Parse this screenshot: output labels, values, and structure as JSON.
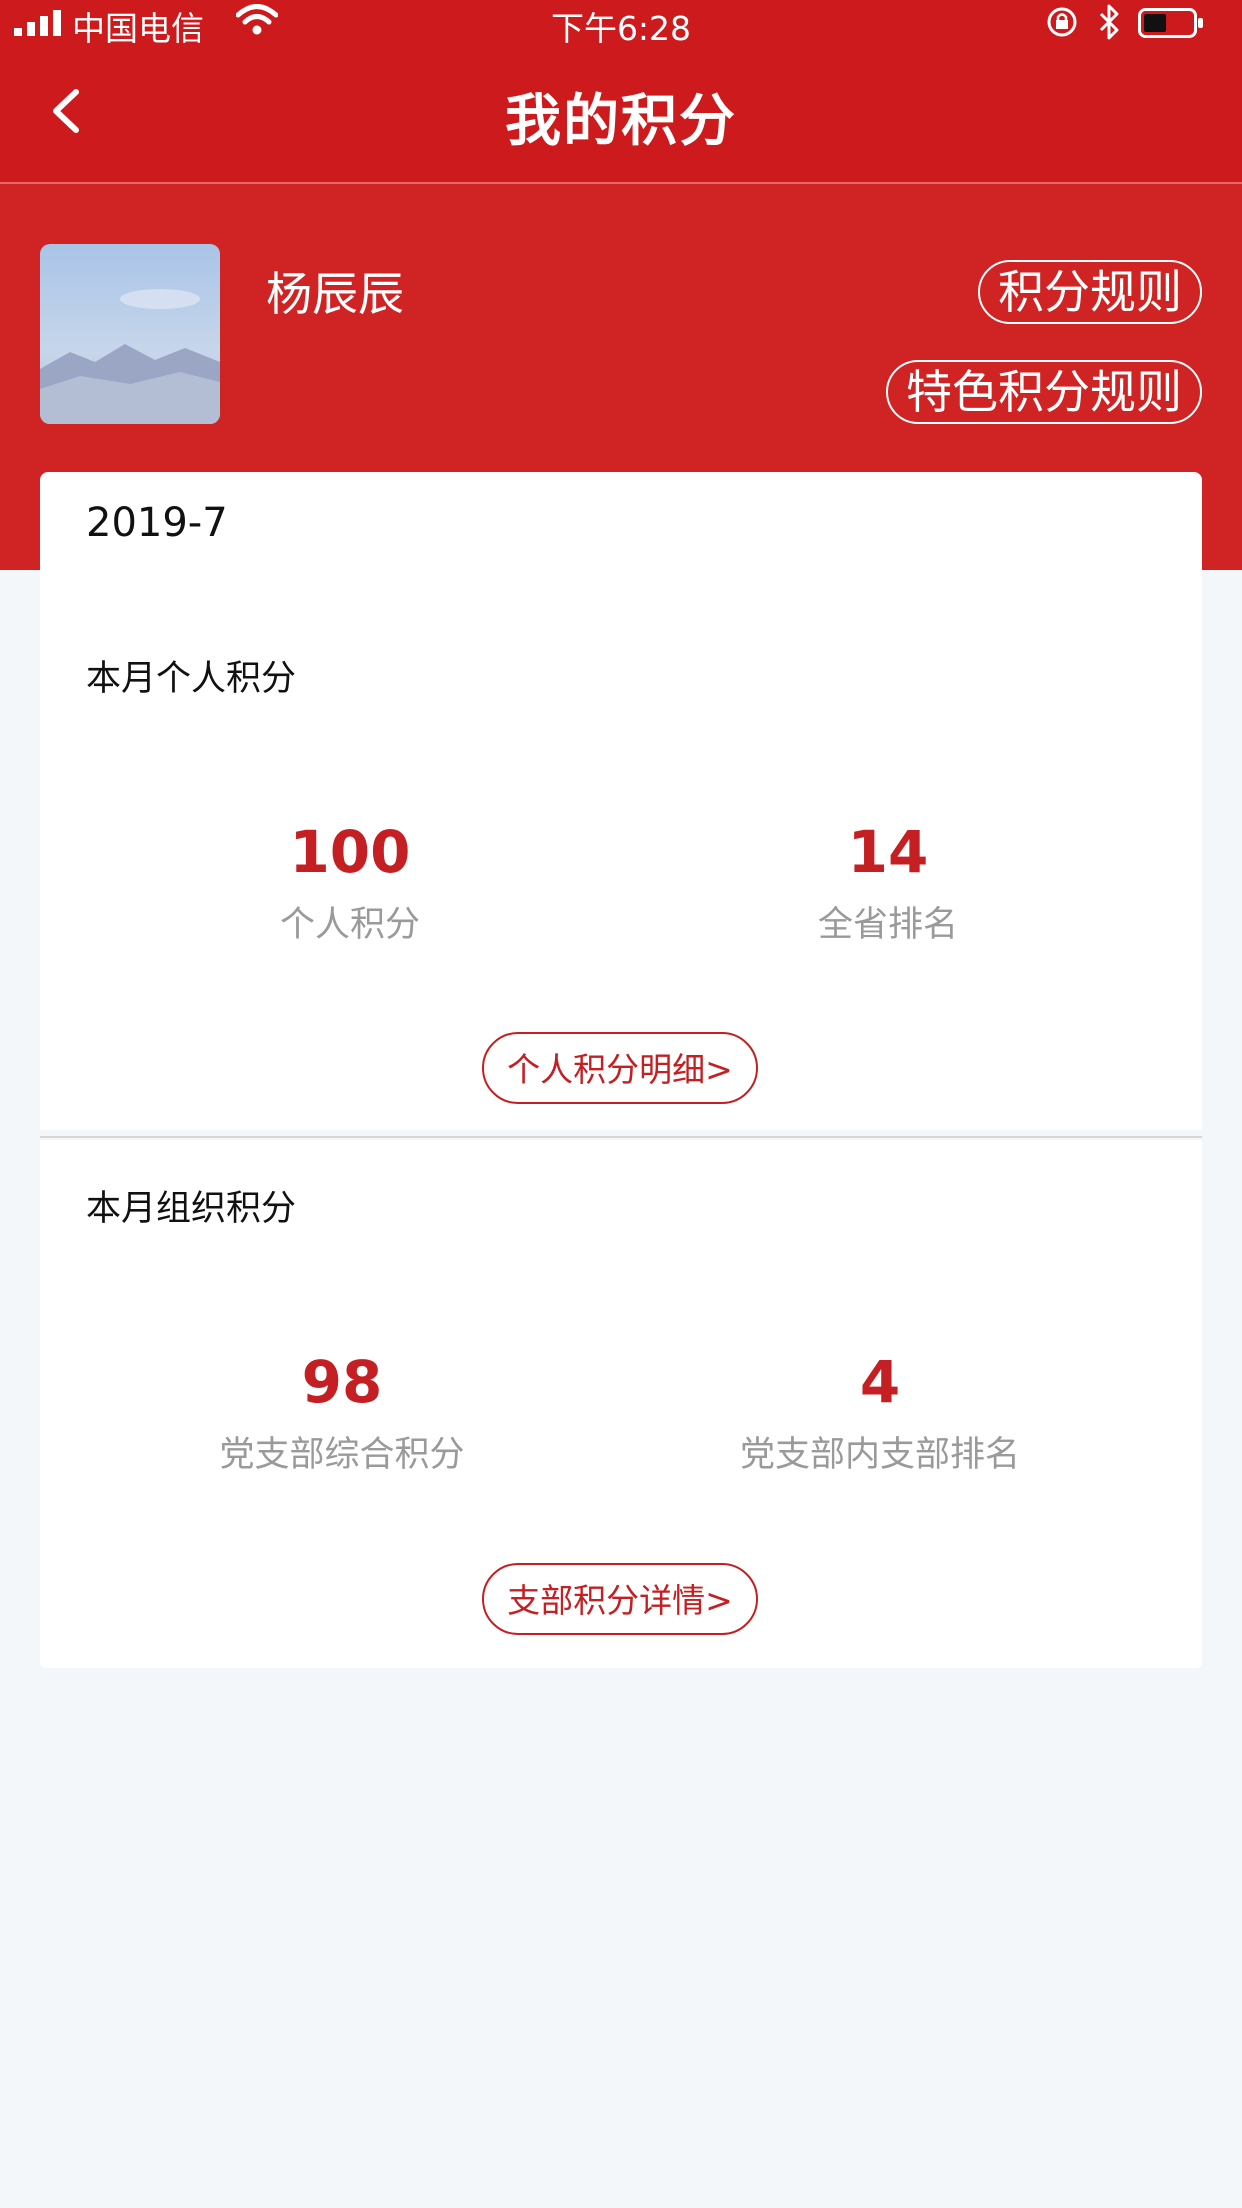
{
  "status_bar": {
    "carrier": "中国电信",
    "time": "下午6:28"
  },
  "nav": {
    "title": "我的积分"
  },
  "profile": {
    "name": "杨辰辰",
    "rules_button": "积分规则",
    "special_rules_button": "特色积分规则"
  },
  "period": "2019-7",
  "personal": {
    "section_title": "本月个人积分",
    "score_value": "100",
    "score_label": "个人积分",
    "rank_value": "14",
    "rank_label": "全省排名",
    "detail_button": "个人积分明细>"
  },
  "organization": {
    "section_title": "本月组织积分",
    "score_value": "98",
    "score_label": "党支部综合积分",
    "rank_value": "4",
    "rank_label": "党支部内支部排名",
    "detail_button": "支部积分详情>"
  },
  "colors": {
    "brand_red": "#cd1a1c",
    "value_red": "#c41f22",
    "page_bg": "#f4f7fa"
  }
}
